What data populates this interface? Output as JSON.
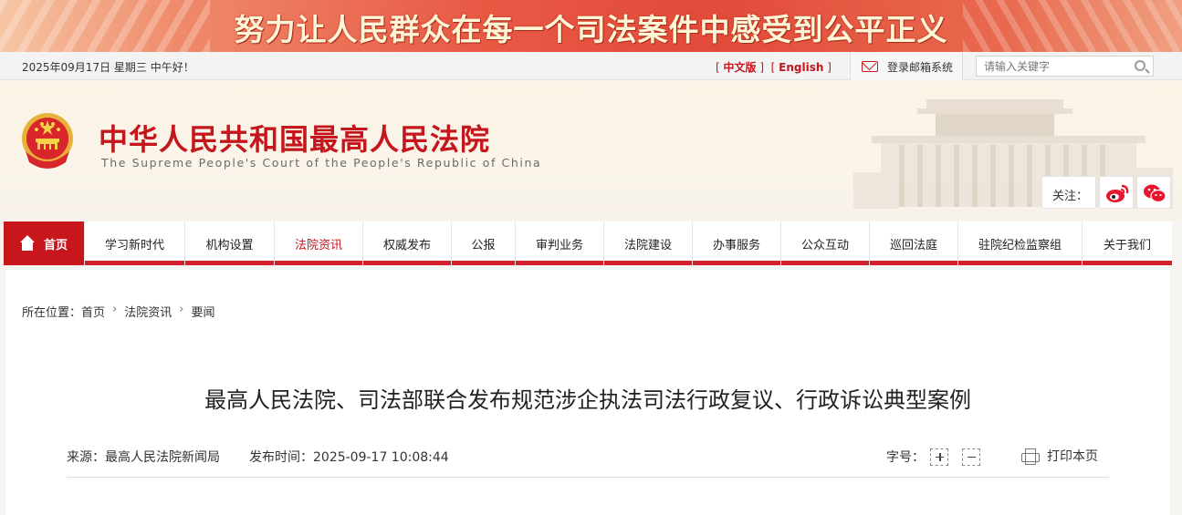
{
  "banner": {
    "slogan": "努力让人民群众在每一个司法案件中感受到公平正义"
  },
  "topbar": {
    "date_greeting": "2025年09月17日 星期三 中午好！",
    "lang_cn": "中文版",
    "lang_en": "English",
    "mail_label": "登录邮箱系统",
    "search_placeholder": "请输入关键字"
  },
  "header": {
    "site_name": "中华人民共和国最高人民法院",
    "site_name_en": "The Supreme People's Court of the People's Republic of China",
    "follow_label": "关注："
  },
  "nav": {
    "items": [
      {
        "label": "首页"
      },
      {
        "label": "学习新时代"
      },
      {
        "label": "机构设置"
      },
      {
        "label": "法院资讯"
      },
      {
        "label": "权威发布"
      },
      {
        "label": "公报"
      },
      {
        "label": "审判业务"
      },
      {
        "label": "法院建设"
      },
      {
        "label": "办事服务"
      },
      {
        "label": "公众互动"
      },
      {
        "label": "巡回法庭"
      },
      {
        "label": "驻院纪检监察组"
      },
      {
        "label": "关于我们"
      }
    ],
    "active": "法院资讯"
  },
  "breadcrumb": {
    "prefix": "所在位置：",
    "items": [
      "首页",
      "法院资讯",
      "要闻"
    ]
  },
  "article": {
    "title": "最高人民法院、司法部联合发布规范涉企执法司法行政复议、行政诉讼典型案例",
    "source": "来源：最高人民法院新闻局",
    "published": "发布时间：2025-09-17 10:08:44",
    "font_size_label": "字号：",
    "print_label": "打印本页"
  },
  "colors": {
    "accent": "#c8161d",
    "title_red": "#c4161c"
  }
}
